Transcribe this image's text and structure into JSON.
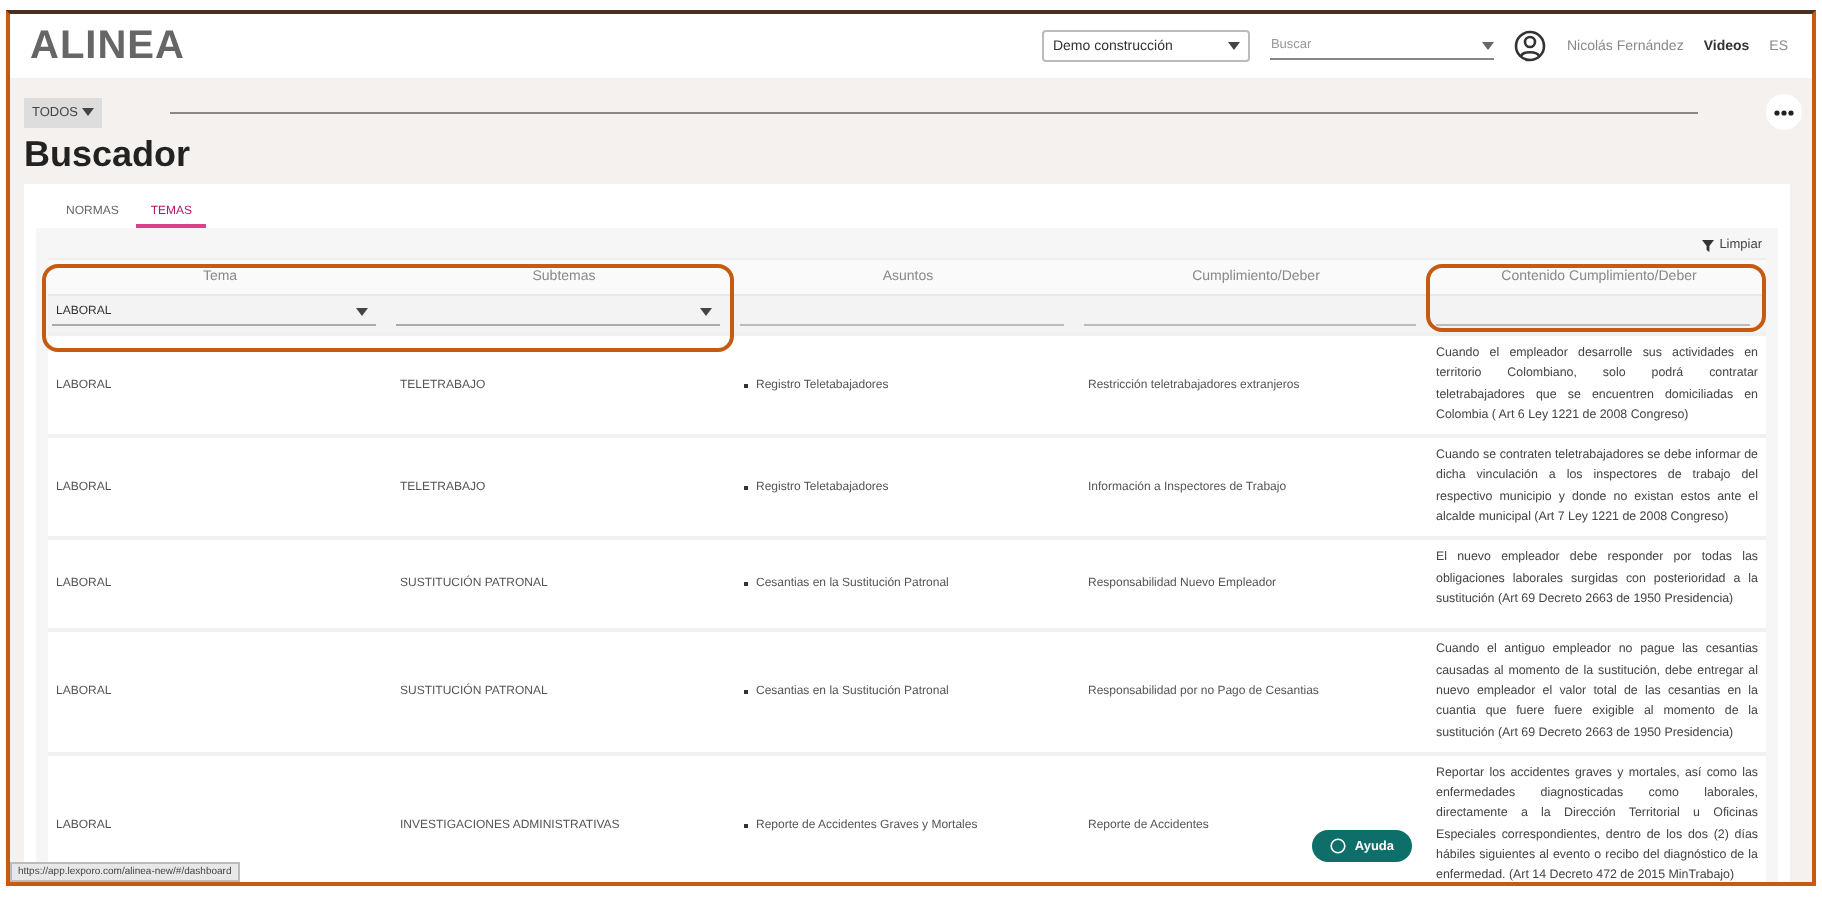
{
  "header": {
    "logo": "ALINEA",
    "project_select": "Demo construcción",
    "search": {
      "placeholder": "Buscar"
    },
    "user_name": "Nicolás Fernández",
    "videos_link": "Videos",
    "language": "ES"
  },
  "toolbar": {
    "filter_button": "TODOS"
  },
  "page_title": "Buscador",
  "tabs": [
    {
      "label": "NORMAS",
      "selected": false
    },
    {
      "label": "TEMAS",
      "selected": true
    }
  ],
  "clear_button": "Limpiar",
  "table": {
    "columns": [
      {
        "label": "Tema",
        "kind": "select",
        "value": "LABORAL",
        "highlighted": true
      },
      {
        "label": "Subtemas",
        "kind": "select",
        "highlighted": true
      },
      {
        "label": "Asuntos",
        "kind": "text",
        "highlighted": false
      },
      {
        "label": "Cumplimiento/Deber",
        "kind": "text",
        "highlighted": false
      },
      {
        "label": "Contenido Cumplimiento/Deber",
        "kind": "text",
        "highlighted": true
      }
    ],
    "rows": [
      {
        "tema": "LABORAL",
        "subtema": "TELETRABAJO",
        "asunto": "Registro Teletabajadores",
        "cumplimiento": "Restricción teletrabajadores extranjeros",
        "contenido": "Cuando el empleador desarrolle sus actividades en territorio Colombiano, solo podrá contratar teletrabajadores que se encuentren domiciliadas en Colombia ( Art 6 Ley 1221 de 2008 Congreso)"
      },
      {
        "tema": "LABORAL",
        "subtema": "TELETRABAJO",
        "asunto": "Registro Teletabajadores",
        "cumplimiento": "Información a Inspectores de Trabajo",
        "contenido": "Cuando se contraten teletrabajadores se debe informar de dicha vinculación a los inspectores de trabajo del respectivo municipio y donde no existan estos ante el alcalde municipal (Art 7 Ley 1221 de 2008 Congreso)"
      },
      {
        "tema": "LABORAL",
        "subtema": "SUSTITUCIÓN PATRONAL",
        "asunto": "Cesantias en la Sustitución Patronal",
        "cumplimiento": "Responsabilidad Nuevo Empleador",
        "contenido": "El nuevo empleador debe responder por todas las obligaciones laborales surgidas con posterioridad a la sustitución (Art 69 Decreto 2663 de 1950 Presidencia)"
      },
      {
        "tema": "LABORAL",
        "subtema": "SUSTITUCIÓN PATRONAL",
        "asunto": "Cesantias en la Sustitución Patronal",
        "cumplimiento": "Responsabilidad por no Pago de Cesantias",
        "contenido": "Cuando el antiguo empleador no pague las cesantias causadas al momento de la sustitución, debe entregar al nuevo empleador el valor total de las cesantias en la cuantia que fuere fuere exigible al momento de la sustitución (Art 69 Decreto 2663 de 1950 Presidencia)"
      },
      {
        "tema": "LABORAL",
        "subtema": "INVESTIGACIONES ADMINISTRATIVAS",
        "asunto": "Reporte de Accidentes Graves y Mortales",
        "cumplimiento": "Reporte de Accidentes",
        "contenido": "Reportar los accidentes graves y mortales, así como las enfermedades diagnosticadas como laborales, directamente a la Dirección Territorial u Oficinas Especiales correspondientes, dentro de los dos (2) días hábiles siguientes al evento o recibo del diagnóstico de la enfermedad. (Art 14 Decreto 472 de 2015 MinTrabajo)"
      }
    ]
  },
  "help_button": "Ayuda",
  "status_url": "https://app.lexporo.com/alinea-new/#/dashboard"
}
